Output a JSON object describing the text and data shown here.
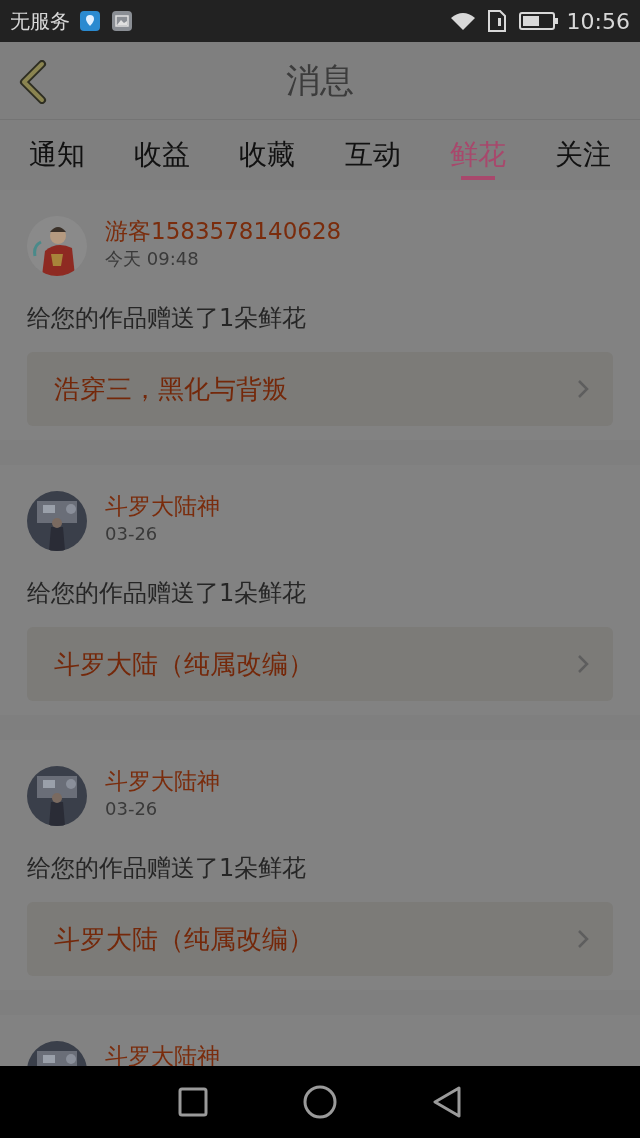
{
  "status_bar": {
    "carrier": "无服务",
    "time": "10:56"
  },
  "header": {
    "title": "消息"
  },
  "tabs": [
    {
      "label": "通知",
      "selected": false
    },
    {
      "label": "收益",
      "selected": false
    },
    {
      "label": "收藏",
      "selected": false
    },
    {
      "label": "互动",
      "selected": false
    },
    {
      "label": "鲜花",
      "selected": true
    },
    {
      "label": "关注",
      "selected": false
    }
  ],
  "messages": [
    {
      "name": "游客1583578140628",
      "time": "今天 09:48",
      "text": "给您的作品赠送了1朵鲜花",
      "work": "浩穿三，黑化与背叛"
    },
    {
      "name": "斗罗大陆神",
      "time": "03-26",
      "text": "给您的作品赠送了1朵鲜花",
      "work": "斗罗大陆（纯属改编）"
    },
    {
      "name": "斗罗大陆神",
      "time": "03-26",
      "text": "给您的作品赠送了1朵鲜花",
      "work": "斗罗大陆（纯属改编）"
    },
    {
      "name": "斗罗大陆神"
    }
  ]
}
